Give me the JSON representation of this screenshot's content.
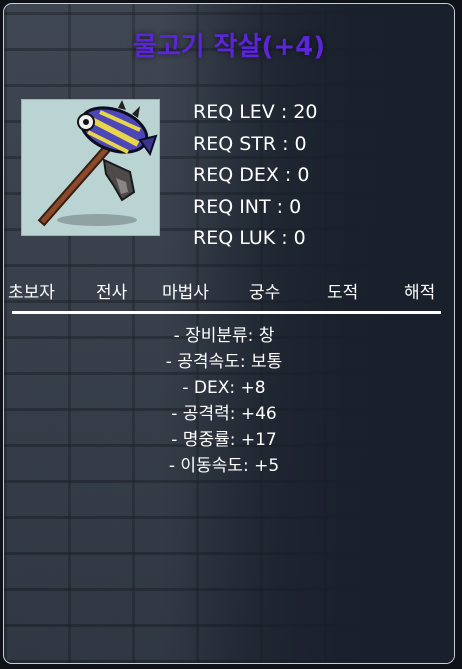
{
  "item": {
    "name": "물고기 작살(+4)",
    "name_color": "#5a26d8"
  },
  "requirements": [
    "REQ LEV : 20",
    "REQ STR : 0",
    "REQ DEX : 0",
    "REQ INT : 0",
    "REQ LUK : 0"
  ],
  "jobs": [
    "초보자",
    "전사",
    "마법사",
    "궁수",
    "도적",
    "해적"
  ],
  "stats": [
    "- 장비분류: 창",
    "- 공격속도: 보통",
    "- DEX: +8",
    "- 공격력: +46",
    "- 명중률: +17",
    "- 이동속도: +5"
  ],
  "icon": "fish-harpoon-icon"
}
